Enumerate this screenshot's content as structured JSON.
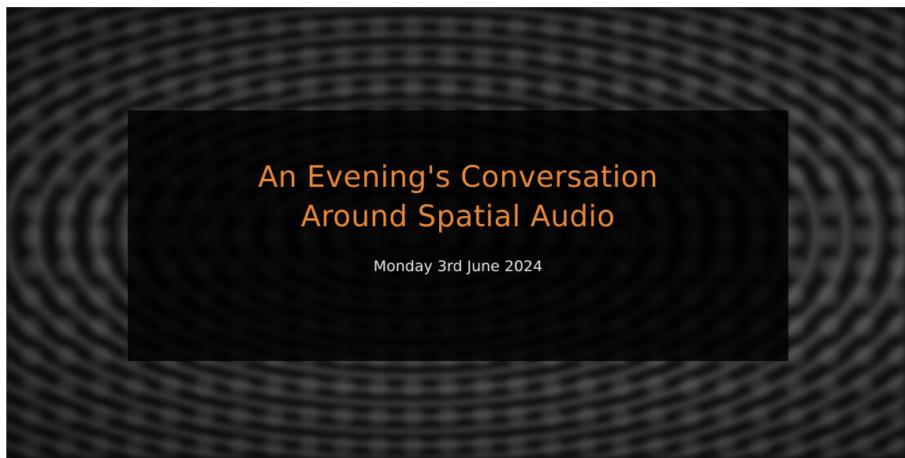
{
  "banner": {
    "title_line_1": "An Evening's Conversation",
    "title_line_2": "Around Spatial Audio",
    "date": "Monday 3rd June 2024"
  },
  "colors": {
    "title": "#e8873a",
    "date": "#e6e6e6",
    "box_background": "#000000"
  },
  "background": {
    "description_icon": "microphone-mesh-image"
  }
}
